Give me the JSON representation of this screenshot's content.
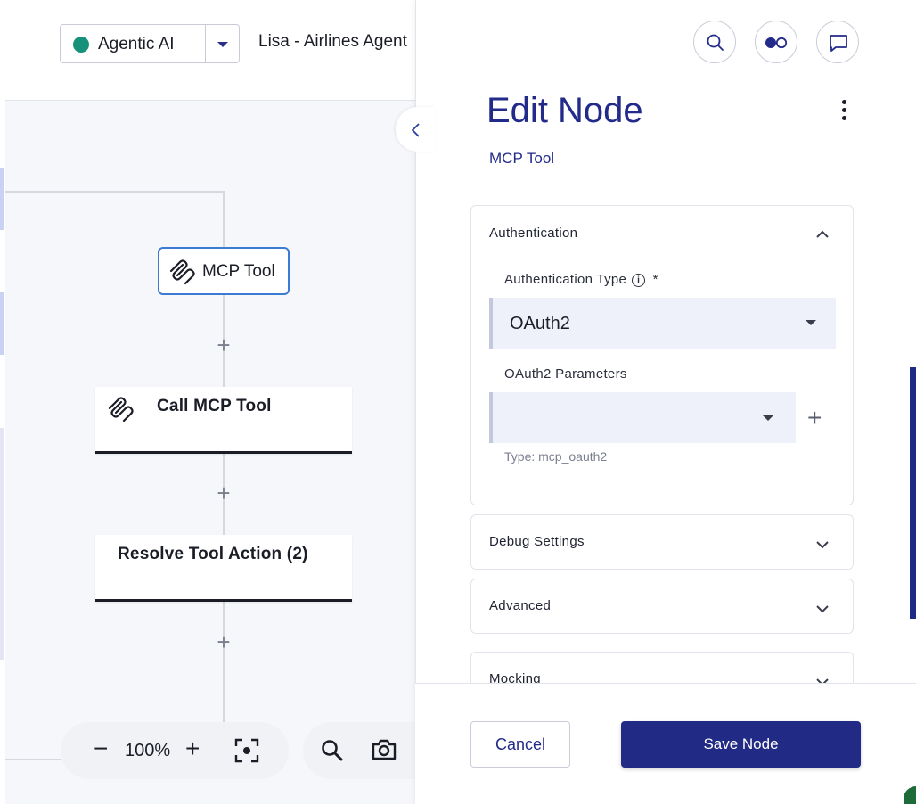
{
  "header": {
    "agent_name": "Agentic AI",
    "project_title": "Lisa - Airlines Agent"
  },
  "canvas": {
    "nodes": [
      {
        "label": "MCP Tool"
      },
      {
        "label": "Call MCP Tool"
      },
      {
        "label": "Resolve Tool Action (2)"
      }
    ],
    "zoom": {
      "minus": "−",
      "value": "100%",
      "plus": "+"
    },
    "add_symbol": "+"
  },
  "panel": {
    "title": "Edit Node",
    "subtitle": "MCP Tool",
    "sections": {
      "authentication": {
        "title": "Authentication",
        "auth_type_label": "Authentication Type",
        "required_mark": "*",
        "auth_type_value": "OAuth2",
        "params_label": "OAuth2 Parameters",
        "params_value": "",
        "params_hint": "Type: mcp_oauth2"
      },
      "debug": {
        "title": "Debug Settings"
      },
      "advanced": {
        "title": "Advanced"
      },
      "mocking": {
        "title": "Mocking"
      }
    },
    "footer": {
      "cancel_label": "Cancel",
      "save_label": "Save Node"
    }
  },
  "icons": {
    "search": "search-icon",
    "toggle": "toggle-icon",
    "chat": "chat-icon",
    "mcp": "mcp-icon",
    "collapse": "chevron-left-icon",
    "fit": "fit-view-icon",
    "camera": "camera-icon"
  },
  "colors": {
    "brand": "#222a8a",
    "agent_dot": "#16927a",
    "selected_node_border": "#3b7bd4"
  }
}
